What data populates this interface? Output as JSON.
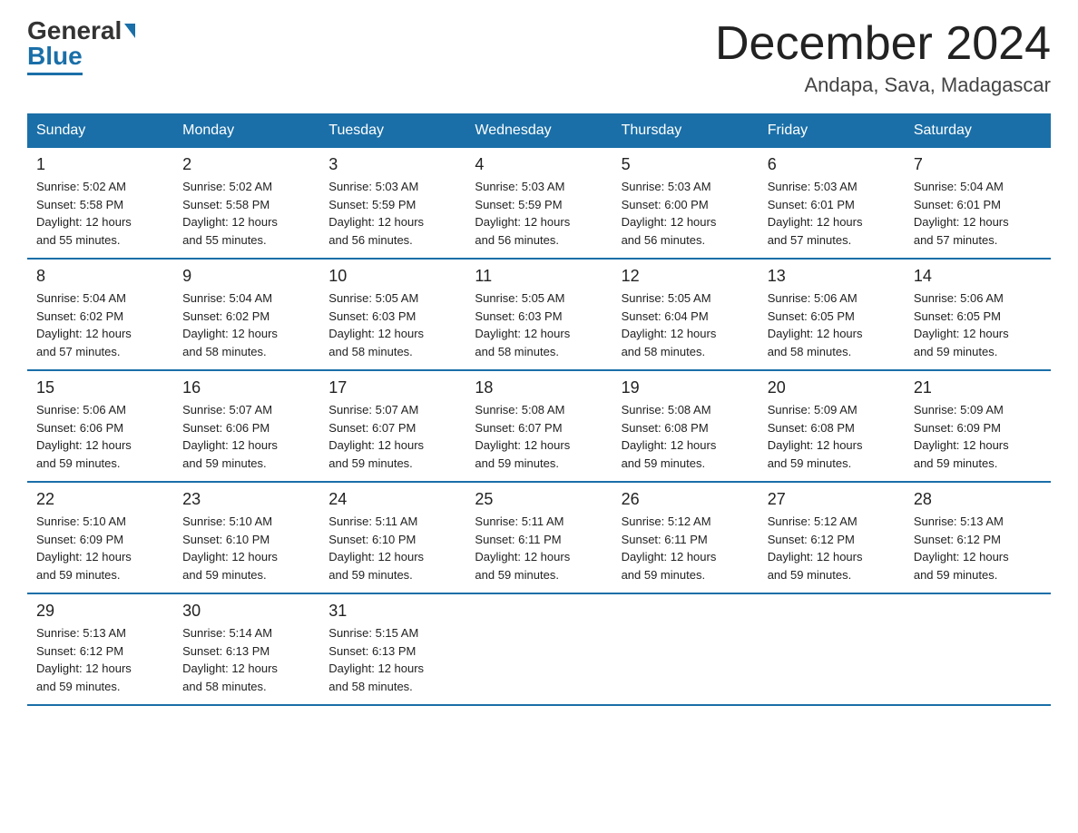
{
  "logo": {
    "general": "General",
    "blue": "Blue"
  },
  "title": {
    "month_year": "December 2024",
    "location": "Andapa, Sava, Madagascar"
  },
  "weekdays": [
    "Sunday",
    "Monday",
    "Tuesday",
    "Wednesday",
    "Thursday",
    "Friday",
    "Saturday"
  ],
  "weeks": [
    [
      {
        "day": "1",
        "sunrise": "5:02 AM",
        "sunset": "5:58 PM",
        "daylight": "12 hours and 55 minutes."
      },
      {
        "day": "2",
        "sunrise": "5:02 AM",
        "sunset": "5:58 PM",
        "daylight": "12 hours and 55 minutes."
      },
      {
        "day": "3",
        "sunrise": "5:03 AM",
        "sunset": "5:59 PM",
        "daylight": "12 hours and 56 minutes."
      },
      {
        "day": "4",
        "sunrise": "5:03 AM",
        "sunset": "5:59 PM",
        "daylight": "12 hours and 56 minutes."
      },
      {
        "day": "5",
        "sunrise": "5:03 AM",
        "sunset": "6:00 PM",
        "daylight": "12 hours and 56 minutes."
      },
      {
        "day": "6",
        "sunrise": "5:03 AM",
        "sunset": "6:01 PM",
        "daylight": "12 hours and 57 minutes."
      },
      {
        "day": "7",
        "sunrise": "5:04 AM",
        "sunset": "6:01 PM",
        "daylight": "12 hours and 57 minutes."
      }
    ],
    [
      {
        "day": "8",
        "sunrise": "5:04 AM",
        "sunset": "6:02 PM",
        "daylight": "12 hours and 57 minutes."
      },
      {
        "day": "9",
        "sunrise": "5:04 AM",
        "sunset": "6:02 PM",
        "daylight": "12 hours and 58 minutes."
      },
      {
        "day": "10",
        "sunrise": "5:05 AM",
        "sunset": "6:03 PM",
        "daylight": "12 hours and 58 minutes."
      },
      {
        "day": "11",
        "sunrise": "5:05 AM",
        "sunset": "6:03 PM",
        "daylight": "12 hours and 58 minutes."
      },
      {
        "day": "12",
        "sunrise": "5:05 AM",
        "sunset": "6:04 PM",
        "daylight": "12 hours and 58 minutes."
      },
      {
        "day": "13",
        "sunrise": "5:06 AM",
        "sunset": "6:05 PM",
        "daylight": "12 hours and 58 minutes."
      },
      {
        "day": "14",
        "sunrise": "5:06 AM",
        "sunset": "6:05 PM",
        "daylight": "12 hours and 59 minutes."
      }
    ],
    [
      {
        "day": "15",
        "sunrise": "5:06 AM",
        "sunset": "6:06 PM",
        "daylight": "12 hours and 59 minutes."
      },
      {
        "day": "16",
        "sunrise": "5:07 AM",
        "sunset": "6:06 PM",
        "daylight": "12 hours and 59 minutes."
      },
      {
        "day": "17",
        "sunrise": "5:07 AM",
        "sunset": "6:07 PM",
        "daylight": "12 hours and 59 minutes."
      },
      {
        "day": "18",
        "sunrise": "5:08 AM",
        "sunset": "6:07 PM",
        "daylight": "12 hours and 59 minutes."
      },
      {
        "day": "19",
        "sunrise": "5:08 AM",
        "sunset": "6:08 PM",
        "daylight": "12 hours and 59 minutes."
      },
      {
        "day": "20",
        "sunrise": "5:09 AM",
        "sunset": "6:08 PM",
        "daylight": "12 hours and 59 minutes."
      },
      {
        "day": "21",
        "sunrise": "5:09 AM",
        "sunset": "6:09 PM",
        "daylight": "12 hours and 59 minutes."
      }
    ],
    [
      {
        "day": "22",
        "sunrise": "5:10 AM",
        "sunset": "6:09 PM",
        "daylight": "12 hours and 59 minutes."
      },
      {
        "day": "23",
        "sunrise": "5:10 AM",
        "sunset": "6:10 PM",
        "daylight": "12 hours and 59 minutes."
      },
      {
        "day": "24",
        "sunrise": "5:11 AM",
        "sunset": "6:10 PM",
        "daylight": "12 hours and 59 minutes."
      },
      {
        "day": "25",
        "sunrise": "5:11 AM",
        "sunset": "6:11 PM",
        "daylight": "12 hours and 59 minutes."
      },
      {
        "day": "26",
        "sunrise": "5:12 AM",
        "sunset": "6:11 PM",
        "daylight": "12 hours and 59 minutes."
      },
      {
        "day": "27",
        "sunrise": "5:12 AM",
        "sunset": "6:12 PM",
        "daylight": "12 hours and 59 minutes."
      },
      {
        "day": "28",
        "sunrise": "5:13 AM",
        "sunset": "6:12 PM",
        "daylight": "12 hours and 59 minutes."
      }
    ],
    [
      {
        "day": "29",
        "sunrise": "5:13 AM",
        "sunset": "6:12 PM",
        "daylight": "12 hours and 59 minutes."
      },
      {
        "day": "30",
        "sunrise": "5:14 AM",
        "sunset": "6:13 PM",
        "daylight": "12 hours and 58 minutes."
      },
      {
        "day": "31",
        "sunrise": "5:15 AM",
        "sunset": "6:13 PM",
        "daylight": "12 hours and 58 minutes."
      },
      null,
      null,
      null,
      null
    ]
  ],
  "labels": {
    "sunrise": "Sunrise:",
    "sunset": "Sunset:",
    "daylight": "Daylight: 12 hours"
  }
}
